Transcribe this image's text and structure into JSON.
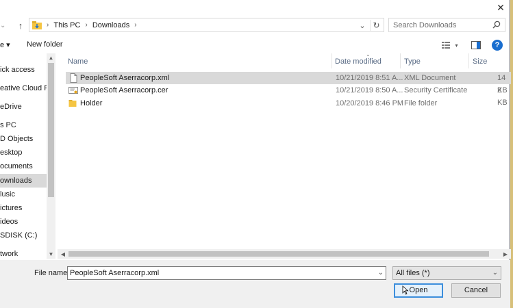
{
  "window": {
    "close_glyph": "✕"
  },
  "address_bar": {
    "crumbs": [
      "This PC",
      "Downloads"
    ],
    "separator": "›",
    "dropdown_glyph": "⌄",
    "refresh_glyph": "↻"
  },
  "search": {
    "placeholder": "Search Downloads"
  },
  "toolbar": {
    "organize_label": "e ▾",
    "new_folder_label": "New folder",
    "help_label": "?"
  },
  "sidebar": {
    "items": [
      {
        "label": "ick access",
        "selected": false
      },
      {
        "label": "eative Cloud Fil",
        "selected": false
      },
      {
        "label": "eDrive",
        "selected": false
      },
      {
        "label": "s PC",
        "selected": false
      },
      {
        "label": "D Objects",
        "selected": false
      },
      {
        "label": "esktop",
        "selected": false
      },
      {
        "label": "ocuments",
        "selected": false
      },
      {
        "label": "ownloads",
        "selected": true
      },
      {
        "label": "lusic",
        "selected": false
      },
      {
        "label": "ictures",
        "selected": false
      },
      {
        "label": "ideos",
        "selected": false
      },
      {
        "label": "SDISK (C:)",
        "selected": false
      },
      {
        "label": "twork",
        "selected": false
      }
    ]
  },
  "columns": {
    "name": "Name",
    "date": "Date modified",
    "type": "Type",
    "size": "Size"
  },
  "files": [
    {
      "name": "PeopleSoft Aserracorp.xml",
      "date": "10/21/2019 8:51 A...",
      "type": "XML Document",
      "size": "14 KB",
      "icon": "xml-file-icon",
      "selected": true
    },
    {
      "name": "PeopleSoft Aserracorp.cer",
      "date": "10/21/2019 8:50 A...",
      "type": "Security Certificate",
      "size": "2 KB",
      "icon": "certificate-file-icon",
      "selected": false
    },
    {
      "name": "Holder",
      "date": "10/20/2019 8:46 PM",
      "type": "File folder",
      "size": "",
      "icon": "folder-icon",
      "selected": false
    }
  ],
  "bottom": {
    "file_name_label": "File name:",
    "file_name_value": "PeopleSoft Aserracorp.xml",
    "filter_value": "All files (*)",
    "open_label": "Open",
    "cancel_label": "Cancel"
  },
  "colors": {
    "accent": "#3c8edc",
    "selection": "#d9d9d9",
    "folder": "#f5c542",
    "help": "#1a6ecf"
  }
}
